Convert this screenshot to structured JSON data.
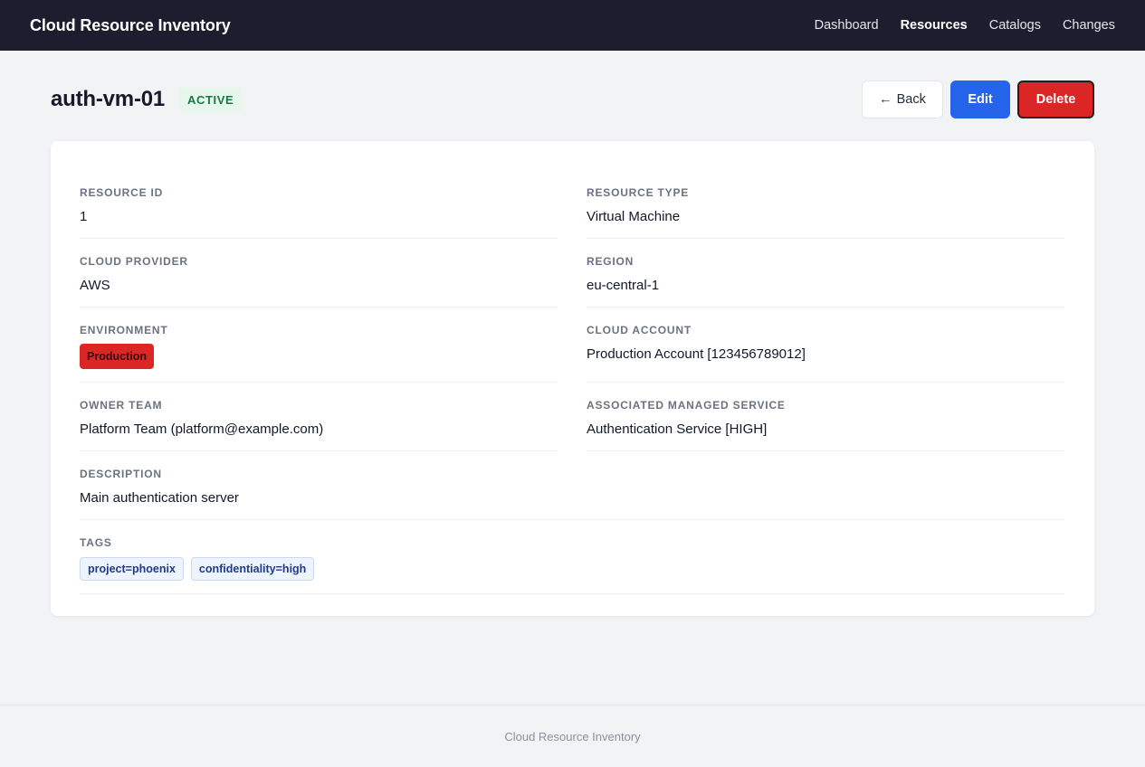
{
  "app": {
    "title": "Cloud Resource Inventory"
  },
  "nav": {
    "items": [
      {
        "label": "Dashboard",
        "active": false
      },
      {
        "label": "Resources",
        "active": true
      },
      {
        "label": "Catalogs",
        "active": false
      },
      {
        "label": "Changes",
        "active": false
      }
    ]
  },
  "resource": {
    "name": "auth-vm-01",
    "status": "ACTIVE"
  },
  "actions": {
    "back_label": "Back",
    "back_icon": "arrow-left-icon",
    "edit_label": "Edit",
    "delete_label": "Delete"
  },
  "fields": {
    "resource_id": {
      "label": "RESOURCE ID",
      "value": "1"
    },
    "resource_type": {
      "label": "RESOURCE TYPE",
      "value": "Virtual Machine"
    },
    "cloud_provider": {
      "label": "CLOUD PROVIDER",
      "value": "AWS"
    },
    "region": {
      "label": "REGION",
      "value": "eu-central-1"
    },
    "environment": {
      "label": "ENVIRONMENT",
      "value": "Production"
    },
    "cloud_account": {
      "label": "CLOUD ACCOUNT",
      "value": "Production Account [123456789012]"
    },
    "owner_team": {
      "label": "OWNER TEAM",
      "value": "Platform Team (platform@example.com)"
    },
    "managed_service": {
      "label": "ASSOCIATED MANAGED SERVICE",
      "value": "Authentication Service [HIGH]"
    },
    "description": {
      "label": "DESCRIPTION",
      "value": "Main authentication server"
    },
    "tags": {
      "label": "TAGS",
      "items": [
        "project=phoenix",
        "confidentiality=high"
      ]
    }
  },
  "footer": {
    "text": "Cloud Resource Inventory"
  },
  "colors": {
    "topbar": "#1c1d2e",
    "edit": "#2563eb",
    "delete": "#dc2626",
    "status_bg": "#e8f7ee",
    "status_text": "#157a43"
  }
}
